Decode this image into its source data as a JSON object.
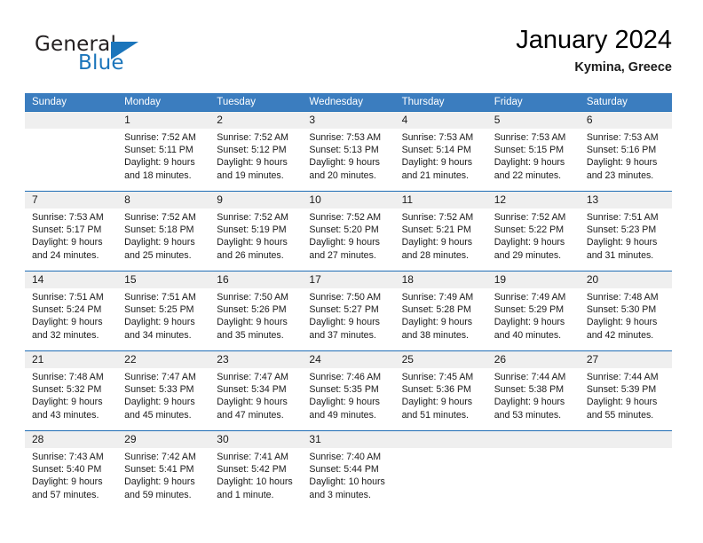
{
  "brand": {
    "name_top": "General",
    "name_bottom": "Blue",
    "accent_color": "#1b75bb",
    "triangle_icon": "blue-triangle-logo-icon"
  },
  "header": {
    "title": "January 2024",
    "subtitle": "Kymina, Greece"
  },
  "theme": {
    "header_row_bg": "#3b7dbf",
    "header_row_text": "#ffffff",
    "week_divider": "#1f6db5",
    "daynum_band_bg": "#efefef"
  },
  "weekdays": [
    "Sunday",
    "Monday",
    "Tuesday",
    "Wednesday",
    "Thursday",
    "Friday",
    "Saturday"
  ],
  "weeks": [
    {
      "days": [
        {
          "num": "",
          "l1": "",
          "l2": "",
          "l3": "",
          "l4": ""
        },
        {
          "num": "1",
          "l1": "Sunrise: 7:52 AM",
          "l2": "Sunset: 5:11 PM",
          "l3": "Daylight: 9 hours",
          "l4": "and 18 minutes."
        },
        {
          "num": "2",
          "l1": "Sunrise: 7:52 AM",
          "l2": "Sunset: 5:12 PM",
          "l3": "Daylight: 9 hours",
          "l4": "and 19 minutes."
        },
        {
          "num": "3",
          "l1": "Sunrise: 7:53 AM",
          "l2": "Sunset: 5:13 PM",
          "l3": "Daylight: 9 hours",
          "l4": "and 20 minutes."
        },
        {
          "num": "4",
          "l1": "Sunrise: 7:53 AM",
          "l2": "Sunset: 5:14 PM",
          "l3": "Daylight: 9 hours",
          "l4": "and 21 minutes."
        },
        {
          "num": "5",
          "l1": "Sunrise: 7:53 AM",
          "l2": "Sunset: 5:15 PM",
          "l3": "Daylight: 9 hours",
          "l4": "and 22 minutes."
        },
        {
          "num": "6",
          "l1": "Sunrise: 7:53 AM",
          "l2": "Sunset: 5:16 PM",
          "l3": "Daylight: 9 hours",
          "l4": "and 23 minutes."
        }
      ]
    },
    {
      "days": [
        {
          "num": "7",
          "l1": "Sunrise: 7:53 AM",
          "l2": "Sunset: 5:17 PM",
          "l3": "Daylight: 9 hours",
          "l4": "and 24 minutes."
        },
        {
          "num": "8",
          "l1": "Sunrise: 7:52 AM",
          "l2": "Sunset: 5:18 PM",
          "l3": "Daylight: 9 hours",
          "l4": "and 25 minutes."
        },
        {
          "num": "9",
          "l1": "Sunrise: 7:52 AM",
          "l2": "Sunset: 5:19 PM",
          "l3": "Daylight: 9 hours",
          "l4": "and 26 minutes."
        },
        {
          "num": "10",
          "l1": "Sunrise: 7:52 AM",
          "l2": "Sunset: 5:20 PM",
          "l3": "Daylight: 9 hours",
          "l4": "and 27 minutes."
        },
        {
          "num": "11",
          "l1": "Sunrise: 7:52 AM",
          "l2": "Sunset: 5:21 PM",
          "l3": "Daylight: 9 hours",
          "l4": "and 28 minutes."
        },
        {
          "num": "12",
          "l1": "Sunrise: 7:52 AM",
          "l2": "Sunset: 5:22 PM",
          "l3": "Daylight: 9 hours",
          "l4": "and 29 minutes."
        },
        {
          "num": "13",
          "l1": "Sunrise: 7:51 AM",
          "l2": "Sunset: 5:23 PM",
          "l3": "Daylight: 9 hours",
          "l4": "and 31 minutes."
        }
      ]
    },
    {
      "days": [
        {
          "num": "14",
          "l1": "Sunrise: 7:51 AM",
          "l2": "Sunset: 5:24 PM",
          "l3": "Daylight: 9 hours",
          "l4": "and 32 minutes."
        },
        {
          "num": "15",
          "l1": "Sunrise: 7:51 AM",
          "l2": "Sunset: 5:25 PM",
          "l3": "Daylight: 9 hours",
          "l4": "and 34 minutes."
        },
        {
          "num": "16",
          "l1": "Sunrise: 7:50 AM",
          "l2": "Sunset: 5:26 PM",
          "l3": "Daylight: 9 hours",
          "l4": "and 35 minutes."
        },
        {
          "num": "17",
          "l1": "Sunrise: 7:50 AM",
          "l2": "Sunset: 5:27 PM",
          "l3": "Daylight: 9 hours",
          "l4": "and 37 minutes."
        },
        {
          "num": "18",
          "l1": "Sunrise: 7:49 AM",
          "l2": "Sunset: 5:28 PM",
          "l3": "Daylight: 9 hours",
          "l4": "and 38 minutes."
        },
        {
          "num": "19",
          "l1": "Sunrise: 7:49 AM",
          "l2": "Sunset: 5:29 PM",
          "l3": "Daylight: 9 hours",
          "l4": "and 40 minutes."
        },
        {
          "num": "20",
          "l1": "Sunrise: 7:48 AM",
          "l2": "Sunset: 5:30 PM",
          "l3": "Daylight: 9 hours",
          "l4": "and 42 minutes."
        }
      ]
    },
    {
      "days": [
        {
          "num": "21",
          "l1": "Sunrise: 7:48 AM",
          "l2": "Sunset: 5:32 PM",
          "l3": "Daylight: 9 hours",
          "l4": "and 43 minutes."
        },
        {
          "num": "22",
          "l1": "Sunrise: 7:47 AM",
          "l2": "Sunset: 5:33 PM",
          "l3": "Daylight: 9 hours",
          "l4": "and 45 minutes."
        },
        {
          "num": "23",
          "l1": "Sunrise: 7:47 AM",
          "l2": "Sunset: 5:34 PM",
          "l3": "Daylight: 9 hours",
          "l4": "and 47 minutes."
        },
        {
          "num": "24",
          "l1": "Sunrise: 7:46 AM",
          "l2": "Sunset: 5:35 PM",
          "l3": "Daylight: 9 hours",
          "l4": "and 49 minutes."
        },
        {
          "num": "25",
          "l1": "Sunrise: 7:45 AM",
          "l2": "Sunset: 5:36 PM",
          "l3": "Daylight: 9 hours",
          "l4": "and 51 minutes."
        },
        {
          "num": "26",
          "l1": "Sunrise: 7:44 AM",
          "l2": "Sunset: 5:38 PM",
          "l3": "Daylight: 9 hours",
          "l4": "and 53 minutes."
        },
        {
          "num": "27",
          "l1": "Sunrise: 7:44 AM",
          "l2": "Sunset: 5:39 PM",
          "l3": "Daylight: 9 hours",
          "l4": "and 55 minutes."
        }
      ]
    },
    {
      "days": [
        {
          "num": "28",
          "l1": "Sunrise: 7:43 AM",
          "l2": "Sunset: 5:40 PM",
          "l3": "Daylight: 9 hours",
          "l4": "and 57 minutes."
        },
        {
          "num": "29",
          "l1": "Sunrise: 7:42 AM",
          "l2": "Sunset: 5:41 PM",
          "l3": "Daylight: 9 hours",
          "l4": "and 59 minutes."
        },
        {
          "num": "30",
          "l1": "Sunrise: 7:41 AM",
          "l2": "Sunset: 5:42 PM",
          "l3": "Daylight: 10 hours",
          "l4": "and 1 minute."
        },
        {
          "num": "31",
          "l1": "Sunrise: 7:40 AM",
          "l2": "Sunset: 5:44 PM",
          "l3": "Daylight: 10 hours",
          "l4": "and 3 minutes."
        },
        {
          "num": "",
          "l1": "",
          "l2": "",
          "l3": "",
          "l4": ""
        },
        {
          "num": "",
          "l1": "",
          "l2": "",
          "l3": "",
          "l4": ""
        },
        {
          "num": "",
          "l1": "",
          "l2": "",
          "l3": "",
          "l4": ""
        }
      ]
    }
  ]
}
